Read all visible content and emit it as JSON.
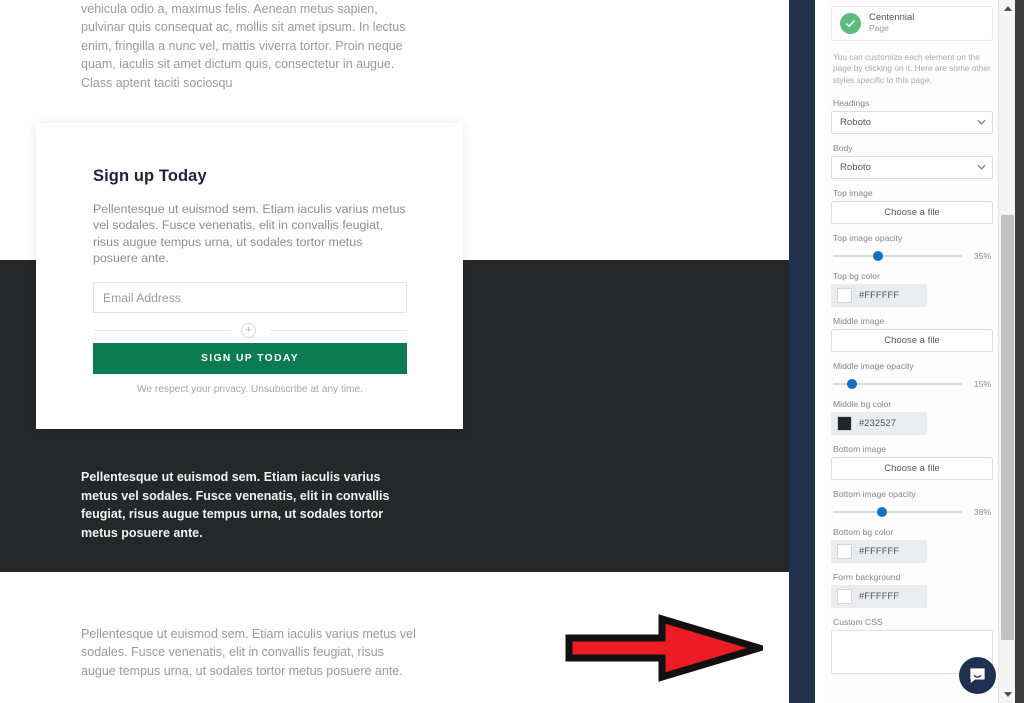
{
  "preview": {
    "top_paragraph": "vehicula odio a, maximus felis. Aenean metus sapien, pulvinar quis consequat ac, mollis sit amet ipsum. In lectus enim, fringilla a nunc vel, mattis viverra tortor. Proin neque quam, iaculis sit amet dictum quis, consectetur in augue. Class aptent taciti sociosqu",
    "signup": {
      "title": "Sign up Today",
      "subtitle": "Pellentesque ut euismod sem. Etiam iaculis varius metus vel sodales. Fusce venenatis, elit in convallis feugiat, risus augue tempus urna, ut sodales tortor metus posuere ante.",
      "email_placeholder": "Email Address",
      "email_value": "",
      "add_field_label": "+",
      "button_label": "SIGN UP TODAY",
      "privacy_note": "We respect your privacy. Unsubscribe at any time."
    },
    "dark_paragraph": "Pellentesque ut euismod sem. Etiam iaculis varius metus vel sodales. Fusce venenatis, elit in convallis feugiat, risus augue tempus urna, ut sodales tortor metus posuere ante.",
    "bottom_paragraph": "Pellentesque ut euismod sem. Etiam iaculis varius metus vel sodales. Fusce venenatis, elit in convallis feugiat, risus augue tempus urna, ut sodales tortor metus posuere ante.",
    "annotation": {
      "shape": "right-arrow",
      "color": "#ED1C24",
      "outline": "#000000"
    }
  },
  "sidebar": {
    "page_chip": {
      "title": "Centennial",
      "subtitle": "Page",
      "status_icon": "check-circle-icon",
      "status_color": "#5FBA7D"
    },
    "helper_text": "You can customize each element on the page by clicking on it. Here are some other styles specific to this page.",
    "fields": {
      "headings": {
        "label": "Headings",
        "value": "Roboto",
        "options": [
          "Roboto"
        ]
      },
      "body": {
        "label": "Body",
        "value": "Roboto",
        "options": [
          "Roboto"
        ]
      },
      "top_image": {
        "label": "Top image",
        "button": "Choose a file"
      },
      "top_image_opacity": {
        "label": "Top image opacity",
        "value": 35,
        "display": "35%"
      },
      "top_bg_color": {
        "label": "Top bg color",
        "value": "#FFFFFF"
      },
      "middle_image": {
        "label": "Middle image",
        "button": "Choose a file"
      },
      "middle_image_opacity": {
        "label": "Middle image opacity",
        "value": 15,
        "display": "15%"
      },
      "middle_bg_color": {
        "label": "Middle bg color",
        "value": "#232527"
      },
      "bottom_image": {
        "label": "Bottom image",
        "button": "Choose a file"
      },
      "bottom_image_opacity": {
        "label": "Bottom image opacity",
        "value": 38,
        "display": "38%"
      },
      "bottom_bg_color": {
        "label": "Bottom bg color",
        "value": "#FFFFFF"
      },
      "form_background": {
        "label": "Form background",
        "value": "#FFFFFF"
      },
      "custom_css": {
        "label": "Custom CSS",
        "value": ""
      }
    }
  },
  "chat": {
    "icon": "chat-bubble-icon",
    "color": "#1F3050"
  }
}
